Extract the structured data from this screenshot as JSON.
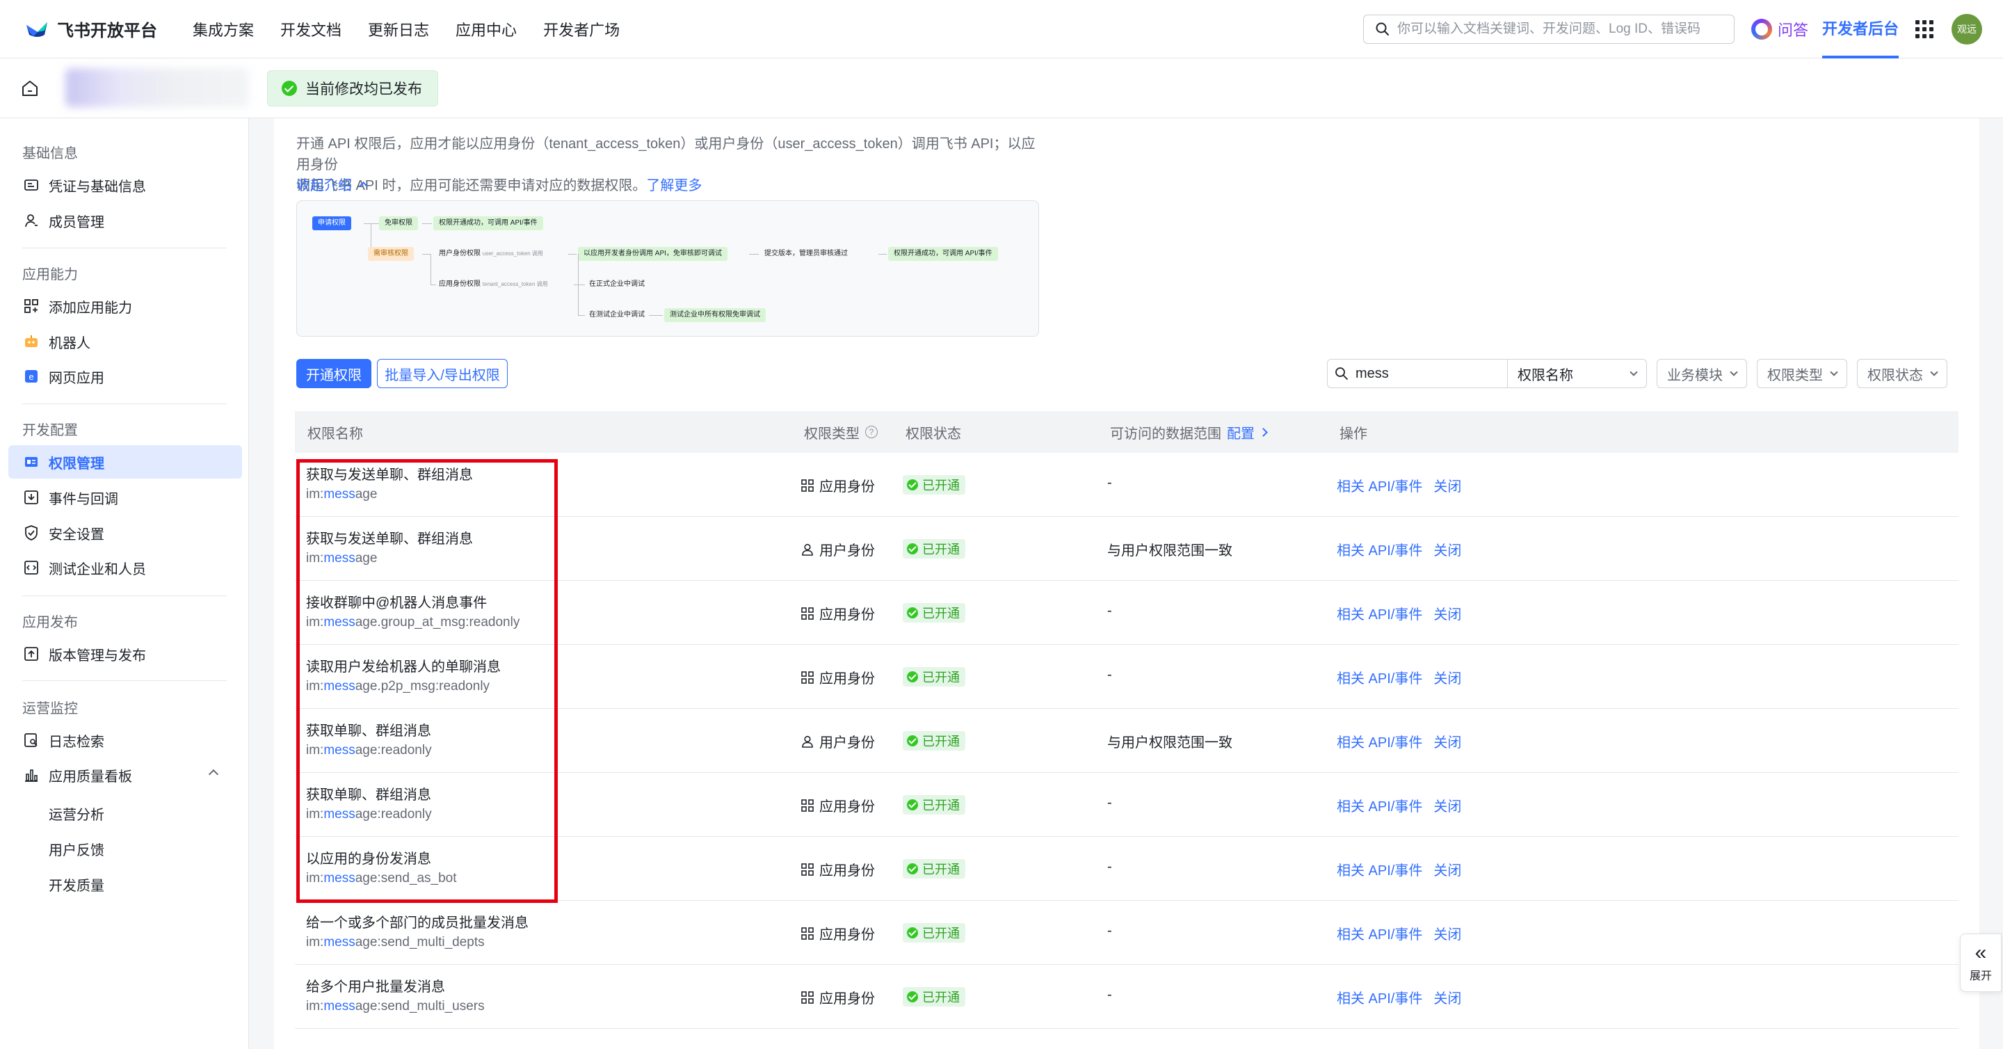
{
  "topnav": {
    "logo": "飞书开放平台",
    "links": [
      "集成方案",
      "开发文档",
      "更新日志",
      "应用中心",
      "开发者广场"
    ],
    "search_placeholder": "你可以输入文档关键词、开发问题、Log ID、错误码",
    "ask": "问答",
    "dev_console": "开发者后台",
    "avatar": "观远"
  },
  "subheader": {
    "published": "当前修改均已发布"
  },
  "sidebar": {
    "groups": {
      "basic": "基础信息",
      "capability": "应用能力",
      "dev_config": "开发配置",
      "release": "应用发布",
      "ops": "运营监控"
    },
    "items": {
      "credentials": "凭证与基础信息",
      "members": "成员管理",
      "add_capability": "添加应用能力",
      "bot": "机器人",
      "web_app": "网页应用",
      "permissions": "权限管理",
      "events": "事件与回调",
      "security": "安全设置",
      "test_enterprise": "测试企业和人员",
      "versions": "版本管理与发布",
      "log_search": "日志检索",
      "quality": "应用质量看板",
      "ops_analysis": "运营分析",
      "feedback": "用户反馈",
      "dev_quality": "开发质量"
    }
  },
  "intro": {
    "line1": "开通 API 权限后，应用才能以应用身份（tenant_access_token）或用户身份（user_access_token）调用飞书 API；以应用身份",
    "line2": "调用飞书 API 时，应用可能还需要申请对应的数据权限。",
    "learn_more": "了解更多",
    "collapse": "收起介绍"
  },
  "flow": {
    "apply": "申请权限",
    "free": "免审权限",
    "free_done": "权限开通成功，可调用 API/事件",
    "review": "需审核权限",
    "user_identity": "用户身份权限",
    "user_token": "user_access_token 调用",
    "dev_debug": "以应用开发者身份调用 API，免审核即可调试",
    "submit": "提交版本，管理员审核通过",
    "review_done": "权限开通成功，可调用 API/事件",
    "app_identity": "应用身份权限",
    "tenant_token": "tenant_access_token 调用",
    "prod_debug": "在正式企业中调试",
    "test_debug": "在测试企业中调试",
    "test_free": "测试企业中所有权限免审调试"
  },
  "toolbar": {
    "open_permission": "开通权限",
    "batch": "批量导入/导出权限",
    "search_value": "mess",
    "search_field": "权限名称",
    "module": "业务模块",
    "perm_type": "权限类型",
    "perm_status": "权限状态"
  },
  "table": {
    "headers": {
      "name": "权限名称",
      "type": "权限类型",
      "status": "权限状态",
      "scope": "可访问的数据范围",
      "config": "配置",
      "ops": "操作"
    },
    "rows": [
      {
        "title": "获取与发送单聊、群组消息",
        "pre": "im:",
        "hl": "mess",
        "post": "age",
        "type": "应用身份",
        "status": "已开通",
        "scope": "-",
        "op1": "相关 API/事件",
        "op2": "关闭"
      },
      {
        "title": "获取与发送单聊、群组消息",
        "pre": "im:",
        "hl": "mess",
        "post": "age",
        "type": "用户身份",
        "status": "已开通",
        "scope": "与用户权限范围一致",
        "op1": "相关 API/事件",
        "op2": "关闭"
      },
      {
        "title": "接收群聊中@机器人消息事件",
        "pre": "im:",
        "hl": "mess",
        "post": "age.group_at_msg:readonly",
        "type": "应用身份",
        "status": "已开通",
        "scope": "-",
        "op1": "相关 API/事件",
        "op2": "关闭"
      },
      {
        "title": "读取用户发给机器人的单聊消息",
        "pre": "im:",
        "hl": "mess",
        "post": "age.p2p_msg:readonly",
        "type": "应用身份",
        "status": "已开通",
        "scope": "-",
        "op1": "相关 API/事件",
        "op2": "关闭"
      },
      {
        "title": "获取单聊、群组消息",
        "pre": "im:",
        "hl": "mess",
        "post": "age:readonly",
        "type": "用户身份",
        "status": "已开通",
        "scope": "与用户权限范围一致",
        "op1": "相关 API/事件",
        "op2": "关闭"
      },
      {
        "title": "获取单聊、群组消息",
        "pre": "im:",
        "hl": "mess",
        "post": "age:readonly",
        "type": "应用身份",
        "status": "已开通",
        "scope": "-",
        "op1": "相关 API/事件",
        "op2": "关闭"
      },
      {
        "title": "以应用的身份发消息",
        "pre": "im:",
        "hl": "mess",
        "post": "age:send_as_bot",
        "type": "应用身份",
        "status": "已开通",
        "scope": "-",
        "op1": "相关 API/事件",
        "op2": "关闭"
      },
      {
        "title": "给一个或多个部门的成员批量发消息",
        "pre": "im:",
        "hl": "mess",
        "post": "age:send_multi_depts",
        "type": "应用身份",
        "status": "已开通",
        "scope": "-",
        "op1": "相关 API/事件",
        "op2": "关闭"
      },
      {
        "title": "给多个用户批量发消息",
        "pre": "im:",
        "hl": "mess",
        "post": "age:send_multi_users",
        "type": "应用身份",
        "status": "已开通",
        "scope": "-",
        "op1": "相关 API/事件",
        "op2": "关闭"
      }
    ]
  },
  "expand": "展开",
  "colors": {
    "accent": "#3370ff",
    "success": "#34c724",
    "highlight_box": "#e60012"
  }
}
